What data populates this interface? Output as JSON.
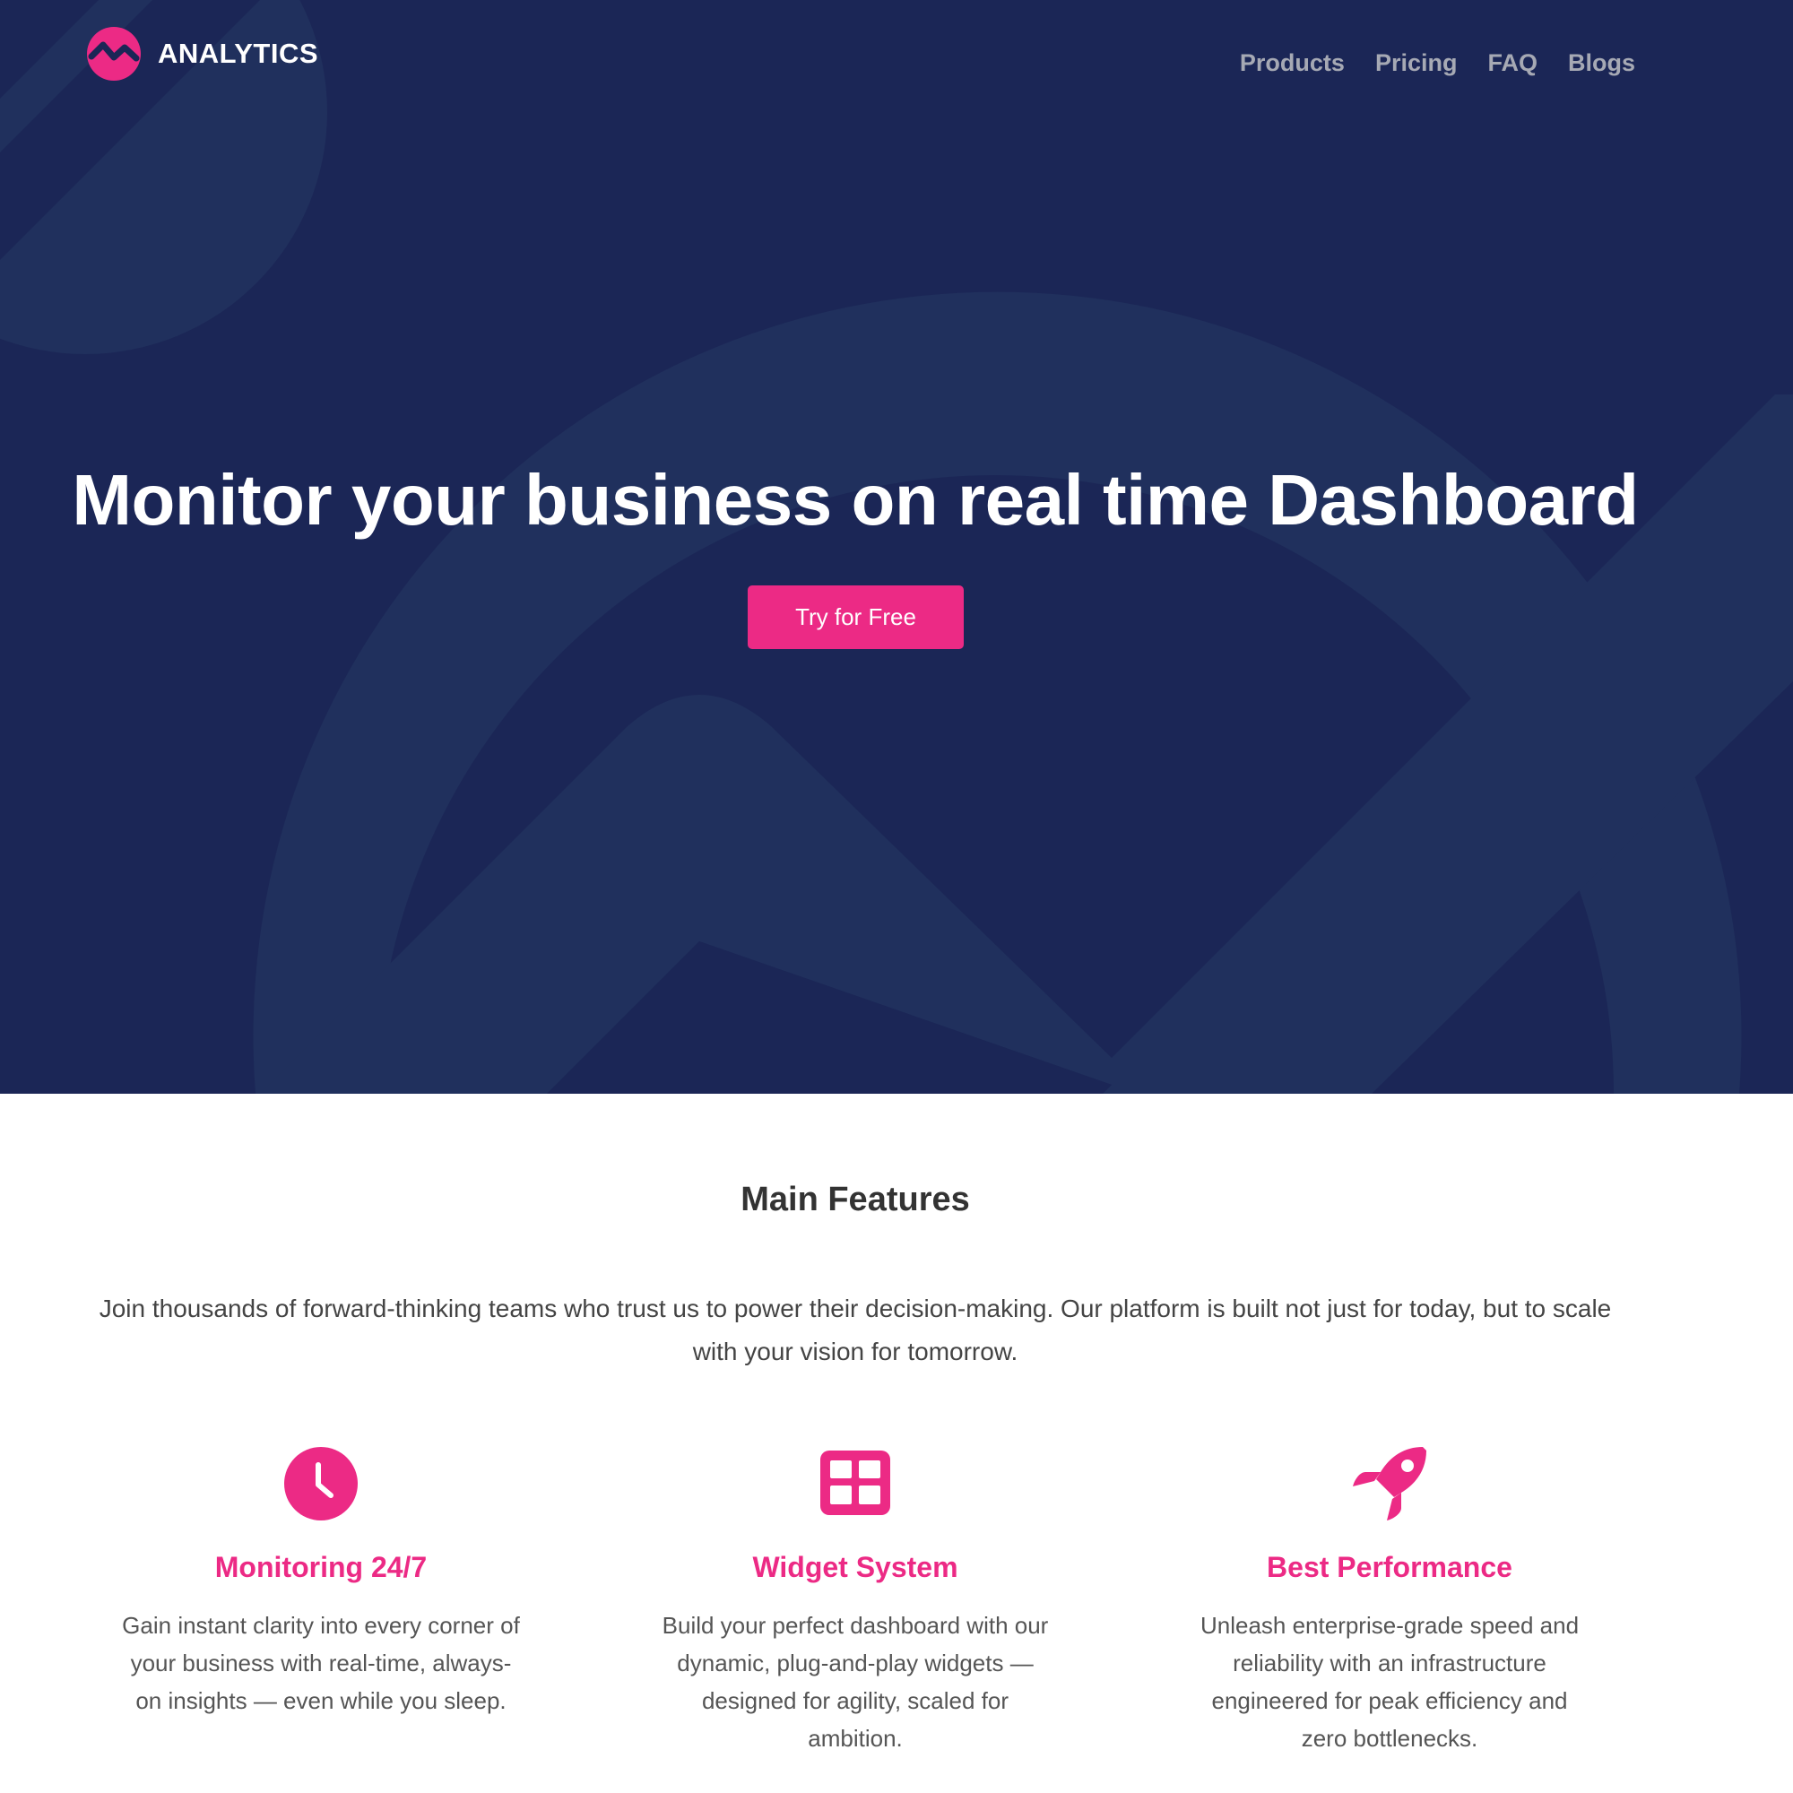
{
  "brand": {
    "name": "ANALYTICS",
    "logo_icon": "trend-line-circle-icon",
    "accent_color": "#ec2a85",
    "hero_color": "#1b2656"
  },
  "nav": {
    "items": [
      "Products",
      "Pricing",
      "FAQ",
      "Blogs"
    ]
  },
  "hero": {
    "title": "Monitor your business on real time Dashboard",
    "cta_label": "Try for Free"
  },
  "features": {
    "title": "Main Features",
    "intro": "Join thousands of forward-thinking teams who trust us to power their decision-making. Our platform is built not just for today, but to scale with your vision for tomorrow.",
    "items": [
      {
        "icon": "clock-icon",
        "title": "Monitoring 24/7",
        "text": "Gain instant clarity into every corner of your business with real-time, always-on insights — even while you sleep."
      },
      {
        "icon": "widget-grid-icon",
        "title": "Widget System",
        "text": "Build your perfect dashboard with our dynamic, plug-and-play widgets — designed for agility, scaled for ambition."
      },
      {
        "icon": "rocket-icon",
        "title": "Best Performance",
        "text": "Unleash enterprise-grade speed and reliability with an infrastructure engineered for peak efficiency and zero bottlenecks."
      }
    ]
  }
}
